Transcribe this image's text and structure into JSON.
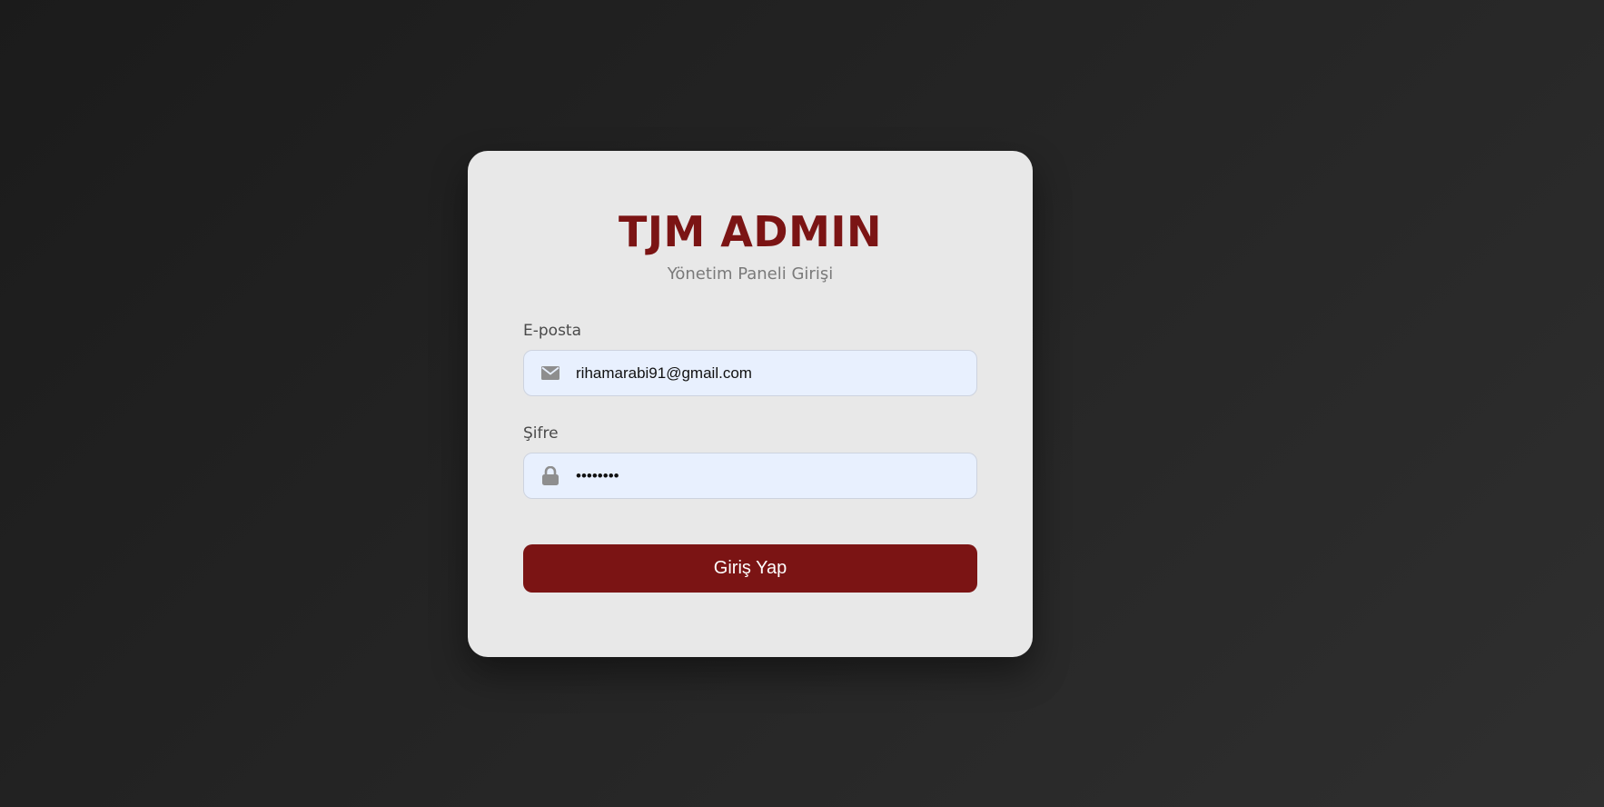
{
  "colors": {
    "brand": "#7b1414",
    "input_bg": "#e8f0fe",
    "icon": "#8e8e8e"
  },
  "login": {
    "title": "TJM ADMIN",
    "subtitle": "Yönetim Paneli Girişi",
    "email": {
      "label": "E-posta",
      "value": "rihamarabi91@gmail.com",
      "icon": "envelope-icon"
    },
    "password": {
      "label": "Şifre",
      "value": "password",
      "icon": "lock-icon"
    },
    "submit_label": "Giriş Yap"
  }
}
